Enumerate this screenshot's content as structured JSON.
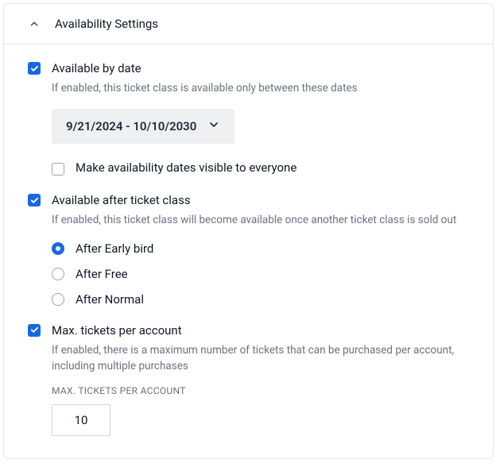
{
  "panel": {
    "title": "Availability Settings"
  },
  "availableByDate": {
    "checked": true,
    "label": "Available by date",
    "description": "If enabled, this ticket class is available only between these dates",
    "dateRange": "9/21/2024 - 10/10/2030",
    "visibility": {
      "checked": false,
      "label": "Make availability dates visible to everyone"
    }
  },
  "availableAfter": {
    "checked": true,
    "label": "Available after ticket class",
    "description": "If enabled, this ticket class will become available once another ticket class is sold out",
    "options": [
      {
        "label": "After Early bird",
        "selected": true
      },
      {
        "label": "After Free",
        "selected": false
      },
      {
        "label": "After Normal",
        "selected": false
      }
    ]
  },
  "maxTickets": {
    "checked": true,
    "label": "Max. tickets per account",
    "description": "If enabled, there is a maximum number of tickets that can be purchased per account, including multiple purchases",
    "fieldCaption": "MAX. TICKETS PER ACCOUNT",
    "value": "10"
  }
}
